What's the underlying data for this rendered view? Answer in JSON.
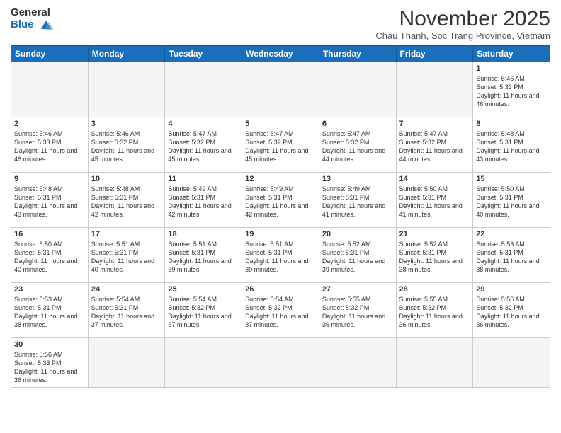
{
  "logo": {
    "line1": "General",
    "line2": "Blue"
  },
  "title": "November 2025",
  "subtitle": "Chau Thanh, Soc Trang Province, Vietnam",
  "weekdays": [
    "Sunday",
    "Monday",
    "Tuesday",
    "Wednesday",
    "Thursday",
    "Friday",
    "Saturday"
  ],
  "days": [
    {
      "day": "",
      "info": ""
    },
    {
      "day": "",
      "info": ""
    },
    {
      "day": "",
      "info": ""
    },
    {
      "day": "",
      "info": ""
    },
    {
      "day": "",
      "info": ""
    },
    {
      "day": "",
      "info": ""
    },
    {
      "day": "1",
      "info": "Sunrise: 5:46 AM\nSunset: 5:33 PM\nDaylight: 11 hours\nand 46 minutes."
    },
    {
      "day": "2",
      "info": "Sunrise: 5:46 AM\nSunset: 5:33 PM\nDaylight: 11 hours\nand 46 minutes."
    },
    {
      "day": "3",
      "info": "Sunrise: 5:46 AM\nSunset: 5:32 PM\nDaylight: 11 hours\nand 45 minutes."
    },
    {
      "day": "4",
      "info": "Sunrise: 5:47 AM\nSunset: 5:32 PM\nDaylight: 11 hours\nand 45 minutes."
    },
    {
      "day": "5",
      "info": "Sunrise: 5:47 AM\nSunset: 5:32 PM\nDaylight: 11 hours\nand 45 minutes."
    },
    {
      "day": "6",
      "info": "Sunrise: 5:47 AM\nSunset: 5:32 PM\nDaylight: 11 hours\nand 44 minutes."
    },
    {
      "day": "7",
      "info": "Sunrise: 5:47 AM\nSunset: 5:32 PM\nDaylight: 11 hours\nand 44 minutes."
    },
    {
      "day": "8",
      "info": "Sunrise: 5:48 AM\nSunset: 5:31 PM\nDaylight: 11 hours\nand 43 minutes."
    },
    {
      "day": "9",
      "info": "Sunrise: 5:48 AM\nSunset: 5:31 PM\nDaylight: 11 hours\nand 43 minutes."
    },
    {
      "day": "10",
      "info": "Sunrise: 5:48 AM\nSunset: 5:31 PM\nDaylight: 11 hours\nand 42 minutes."
    },
    {
      "day": "11",
      "info": "Sunrise: 5:49 AM\nSunset: 5:31 PM\nDaylight: 11 hours\nand 42 minutes."
    },
    {
      "day": "12",
      "info": "Sunrise: 5:49 AM\nSunset: 5:31 PM\nDaylight: 11 hours\nand 42 minutes."
    },
    {
      "day": "13",
      "info": "Sunrise: 5:49 AM\nSunset: 5:31 PM\nDaylight: 11 hours\nand 41 minutes."
    },
    {
      "day": "14",
      "info": "Sunrise: 5:50 AM\nSunset: 5:31 PM\nDaylight: 11 hours\nand 41 minutes."
    },
    {
      "day": "15",
      "info": "Sunrise: 5:50 AM\nSunset: 5:31 PM\nDaylight: 11 hours\nand 40 minutes."
    },
    {
      "day": "16",
      "info": "Sunrise: 5:50 AM\nSunset: 5:31 PM\nDaylight: 11 hours\nand 40 minutes."
    },
    {
      "day": "17",
      "info": "Sunrise: 5:51 AM\nSunset: 5:31 PM\nDaylight: 11 hours\nand 40 minutes."
    },
    {
      "day": "18",
      "info": "Sunrise: 5:51 AM\nSunset: 5:31 PM\nDaylight: 11 hours\nand 39 minutes."
    },
    {
      "day": "19",
      "info": "Sunrise: 5:51 AM\nSunset: 5:31 PM\nDaylight: 11 hours\nand 39 minutes."
    },
    {
      "day": "20",
      "info": "Sunrise: 5:52 AM\nSunset: 5:31 PM\nDaylight: 11 hours\nand 39 minutes."
    },
    {
      "day": "21",
      "info": "Sunrise: 5:52 AM\nSunset: 5:31 PM\nDaylight: 11 hours\nand 38 minutes."
    },
    {
      "day": "22",
      "info": "Sunrise: 5:53 AM\nSunset: 5:31 PM\nDaylight: 11 hours\nand 38 minutes."
    },
    {
      "day": "23",
      "info": "Sunrise: 5:53 AM\nSunset: 5:31 PM\nDaylight: 11 hours\nand 38 minutes."
    },
    {
      "day": "24",
      "info": "Sunrise: 5:54 AM\nSunset: 5:31 PM\nDaylight: 11 hours\nand 37 minutes."
    },
    {
      "day": "25",
      "info": "Sunrise: 5:54 AM\nSunset: 5:32 PM\nDaylight: 11 hours\nand 37 minutes."
    },
    {
      "day": "26",
      "info": "Sunrise: 5:54 AM\nSunset: 5:32 PM\nDaylight: 11 hours\nand 37 minutes."
    },
    {
      "day": "27",
      "info": "Sunrise: 5:55 AM\nSunset: 5:32 PM\nDaylight: 11 hours\nand 36 minutes."
    },
    {
      "day": "28",
      "info": "Sunrise: 5:55 AM\nSunset: 5:32 PM\nDaylight: 11 hours\nand 36 minutes."
    },
    {
      "day": "29",
      "info": "Sunrise: 5:56 AM\nSunset: 5:32 PM\nDaylight: 11 hours\nand 36 minutes."
    },
    {
      "day": "30",
      "info": "Sunrise: 5:56 AM\nSunset: 5:33 PM\nDaylight: 11 hours\nand 36 minutes."
    },
    {
      "day": "",
      "info": ""
    },
    {
      "day": "",
      "info": ""
    },
    {
      "day": "",
      "info": ""
    },
    {
      "day": "",
      "info": ""
    },
    {
      "day": "",
      "info": ""
    },
    {
      "day": "",
      "info": ""
    }
  ]
}
